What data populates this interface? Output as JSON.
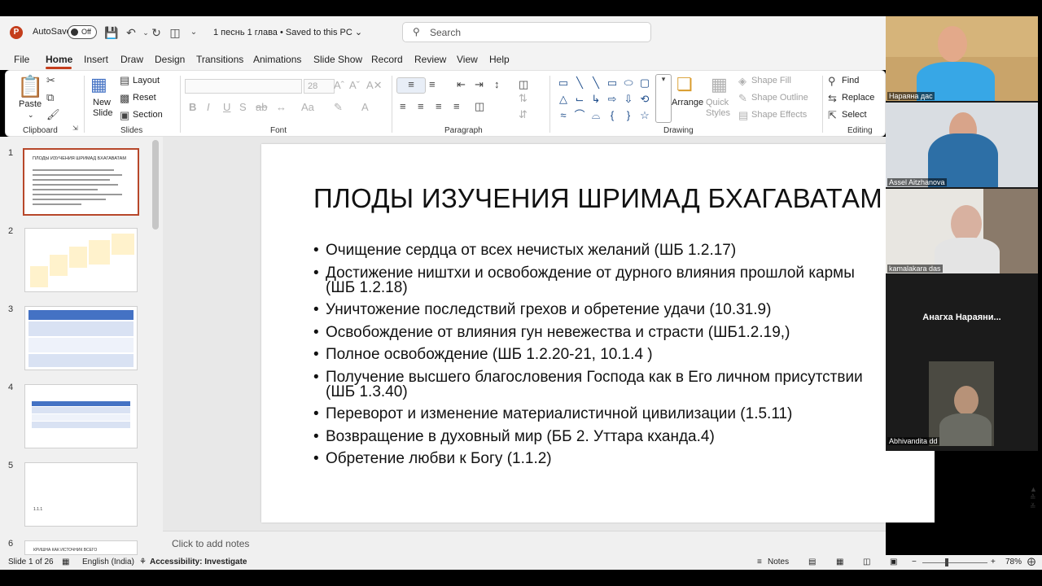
{
  "app": {
    "logo_letter": "P",
    "autosave_label": "AutoSave",
    "autosave_state": "Off",
    "doc_title": "1 песнь 1 глава • Saved to this PC ⌄",
    "search_placeholder": "Search"
  },
  "menu": {
    "tabs": [
      "File",
      "Home",
      "Insert",
      "Draw",
      "Design",
      "Transitions",
      "Animations",
      "Slide Show",
      "Record",
      "Review",
      "View",
      "Help"
    ],
    "active_tab": "Home"
  },
  "ribbon": {
    "clipboard": {
      "paste": "Paste",
      "label": "Clipboard"
    },
    "slides": {
      "new_slide": "New Slide",
      "layout": "Layout",
      "reset": "Reset",
      "section": "Section",
      "label": "Slides"
    },
    "font": {
      "size": "28",
      "label": "Font"
    },
    "paragraph": {
      "label": "Paragraph"
    },
    "drawing": {
      "arrange": "Arrange",
      "quick_styles": "Quick Styles",
      "shape_fill": "Shape Fill",
      "shape_outline": "Shape Outline",
      "shape_effects": "Shape Effects",
      "label": "Drawing"
    },
    "editing": {
      "find": "Find",
      "replace": "Replace",
      "select": "Select",
      "label": "Editing"
    }
  },
  "thumbnails": [
    {
      "num": "1",
      "title": "ПЛОДЫ ИЗУЧЕНИЯ ШРИМАД БХАГАВАТАМ"
    },
    {
      "num": "2",
      "title": ""
    },
    {
      "num": "3",
      "title": ""
    },
    {
      "num": "4",
      "title": ""
    },
    {
      "num": "5",
      "title": "1.1.1"
    },
    {
      "num": "6",
      "title": "КРИШНА КАК ИСТОЧНИК ВСЕГО"
    }
  ],
  "slide": {
    "title": "ПЛОДЫ ИЗУЧЕНИЯ ШРИМАД БХАГАВАТАМ",
    "bullets": [
      "Очищение сердца от всех нечистых желаний (ШБ 1.2.17)",
      "Достижение ништхи и освобождение от дурного влияния прошлой кармы (ШБ 1.2.18)",
      "Уничтожение последствий грехов и обретение удачи (10.31.9)",
      "Освобождение от влияния гун невежества и страсти (ШБ1.2.19,)",
      "Полное освобождение (ШБ 1.2.20-21, 10.1.4 )",
      "Получение высшего благословения Господа как в Его личном присутствии (ШБ 1.3.40)",
      "Переворот и изменение материалистичной цивилизации (1.5.11)",
      "Возвращение в духовный мир (ББ 2. Уттара кханда.4)",
      "Обретение любви к Богу (1.1.2)"
    ]
  },
  "notes_placeholder": "Click to add notes",
  "status": {
    "slide_info": "Slide 1 of 26",
    "language": "English (India)",
    "accessibility": "Accessibility: Investigate",
    "notes": "Notes",
    "zoom": "78%"
  },
  "participants": [
    {
      "name": "Нараяна дас"
    },
    {
      "name": "Assel Aitzhanova"
    },
    {
      "name": "kamalakara das"
    },
    {
      "name": "Анагха  Нараяни..."
    },
    {
      "name": "Abhivandita dd"
    }
  ],
  "colors": {
    "accent": "#c43e1c",
    "thumb_selected": "#b7472a"
  }
}
